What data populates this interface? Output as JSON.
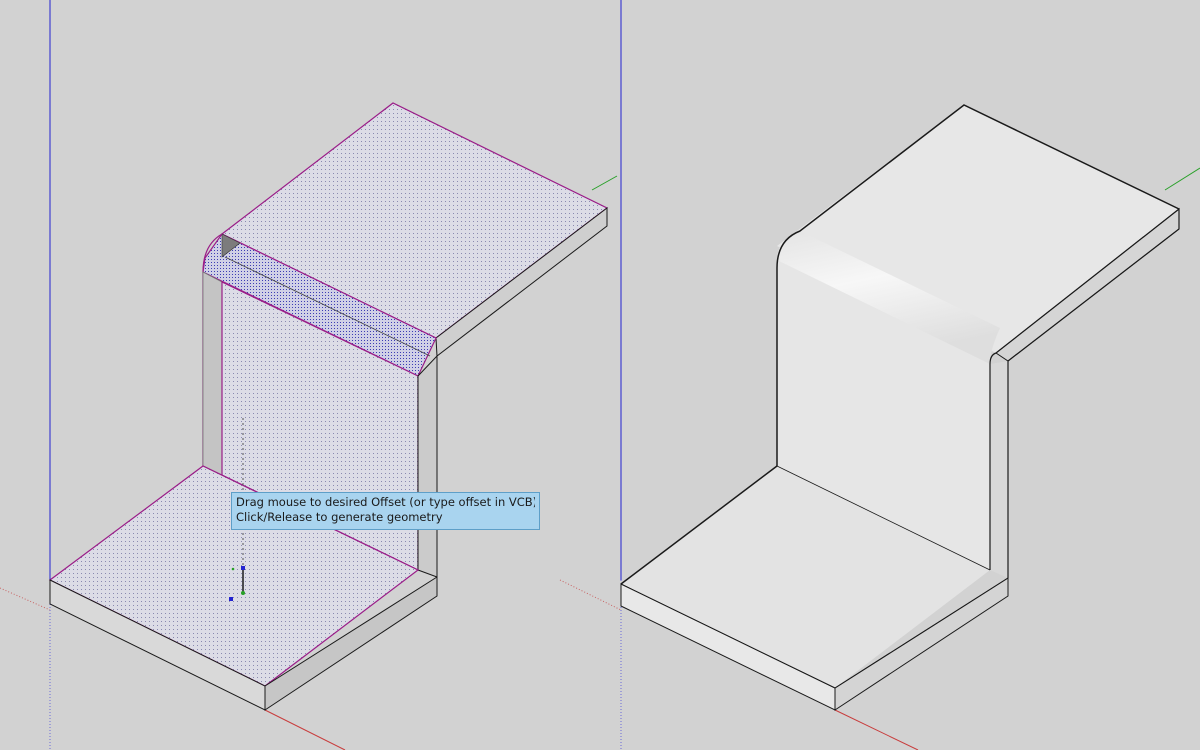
{
  "tooltip": {
    "line1": "Drag mouse to desired Offset (or type offset in VCB)",
    "line2": "Click/Release to generate geometry"
  },
  "colors": {
    "background": "#d2d2d2",
    "blue_axis": "#2323d0",
    "red_axis": "#c83c3c",
    "green_axis": "#28a028",
    "selection": "#9a1d88",
    "edge": "#1a1a1a",
    "face_selected": "#d9d9e3",
    "face_light": "#e7e7e7",
    "tooltip_bg": "#a9d4ef"
  },
  "viewport": {
    "left_model": "offset-in-progress",
    "right_model": "result-geometry",
    "icons": [
      "offset-cursor-icon"
    ]
  }
}
